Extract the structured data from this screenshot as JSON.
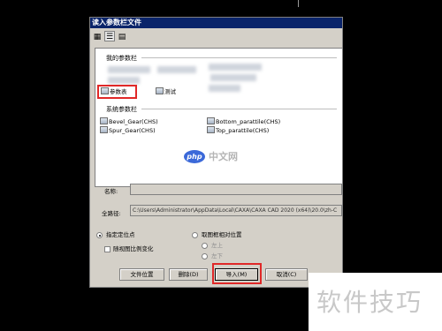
{
  "window": {
    "title": "读入参数栏文件"
  },
  "toolbar": {
    "buttons": [
      {
        "icon": "large-icons-view-icon",
        "glyph": "▦"
      },
      {
        "icon": "list-view-icon",
        "glyph": "☰"
      },
      {
        "icon": "details-view-icon",
        "glyph": "▤"
      }
    ]
  },
  "my_group": {
    "label": "我的参数栏",
    "items": [
      {
        "label": "参数表",
        "icon": "parameter-file-icon"
      },
      {
        "label": "测试",
        "icon": "parameter-file-icon"
      }
    ]
  },
  "system_group": {
    "label": "系统参数栏",
    "items": [
      {
        "label": "Bevel_Gear(CHS)",
        "icon": "parameter-file-icon"
      },
      {
        "label": "Bottom_parattile(CHS)",
        "icon": "parameter-file-icon"
      },
      {
        "label": "Spur_Gear(CHS)",
        "icon": "parameter-file-icon"
      },
      {
        "label": "Top_parattile(CHS)",
        "icon": "parameter-file-icon"
      }
    ]
  },
  "watermark": {
    "logo": "php",
    "site": "中文网",
    "corner": "软件技巧"
  },
  "fields": {
    "name_label": "名称:",
    "name_value": "",
    "path_label": "全路径:",
    "path_value": "C:\\Users\\Administrator\\AppData\\Local\\CAXA\\CAXA CAD 2020 (x64)\\20.0\\zh-C"
  },
  "positioning": {
    "specified": {
      "label": "指定定位点",
      "selected": true
    },
    "follow_scale": {
      "label": "随视图比例变化",
      "checked": false
    },
    "relative": {
      "label": "取图框相对位置",
      "selected": false
    },
    "left_top": {
      "label": "左上",
      "selected": false
    },
    "left_bottom": {
      "label": "左下",
      "selected": false
    }
  },
  "buttons": {
    "file_location": "文件位置",
    "delete": "删除(D)",
    "import": "导入(M)",
    "cancel": "取消(C)"
  },
  "colors": {
    "highlight": "#e02828",
    "title_bar": "#0a246a"
  }
}
